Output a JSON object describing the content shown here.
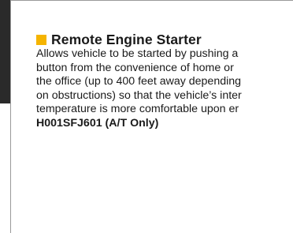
{
  "accent_color": "#f5b400",
  "section": {
    "title": "Remote Engine Starter",
    "description_lines": [
      "Allows vehicle to be started by pushing a",
      "button from the convenience of home or",
      "the office (up to 400 feet away depending",
      "on obstructions) so that the vehicle’s inter",
      "temperature is more comfortable upon er"
    ],
    "part_number": "H001SFJ601 (A/T Only)"
  }
}
